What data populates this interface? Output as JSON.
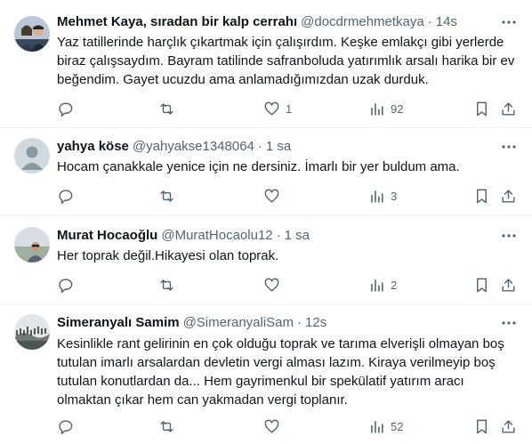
{
  "tweets": [
    {
      "name": "Mehmet Kaya, sıradan bir kalp cerrahı",
      "handle": "@docdrmehmetkaya",
      "time": "14s",
      "text": "Yaz tatillerinde harçlık çıkartmak için çalışırdım. Keşke emlakçı gibi yerlerde biraz çalışsaydım. Bayram tatilinde safranboluda yatırımlık arsalı harika bir ev beğendim. Gayet ucuzdu ama anlamadığımızdan uzak durduk.",
      "replies": "",
      "retweets": "",
      "likes": "1",
      "views": "92",
      "avatar": "couple-photo"
    },
    {
      "name": "yahya köse",
      "handle": "@yahyakse1348064",
      "time": "1 sa",
      "text": "Hocam çanakkale yenice için ne dersiniz. İmarlı bir yer buldum ama.",
      "replies": "",
      "retweets": "",
      "likes": "",
      "views": "3",
      "avatar": "default-avatar"
    },
    {
      "name": "Murat Hocaoğlu",
      "handle": "@MuratHocaolu12",
      "time": "1 sa",
      "text": "Her toprak değil.Hikayesi olan toprak.",
      "replies": "",
      "retweets": "",
      "likes": "",
      "views": "2",
      "avatar": "man-photo"
    },
    {
      "name": "Simeranyalı Samim",
      "handle": "@SimeranyaliSam",
      "time": "12s",
      "text": "Kesinlikle rant gelirinin en çok olduğu toprak ve tarıma elverişli olmayan boş tutulan imarlı arsalardan devletin vergi alması lazım. Kiraya verilmeyip boş tutulan konutlardan da... Hem gayrimenkul bir spekülatif yatırım aracı olmaktan çıkar hem can yakmadan vergi toplanır.",
      "replies": "",
      "retweets": "",
      "likes": "",
      "views": "52",
      "avatar": "landscape-photo"
    }
  ],
  "separator": "·",
  "colors": {
    "text": "#0f1419",
    "secondary": "#536471",
    "border": "#eff3f4"
  }
}
